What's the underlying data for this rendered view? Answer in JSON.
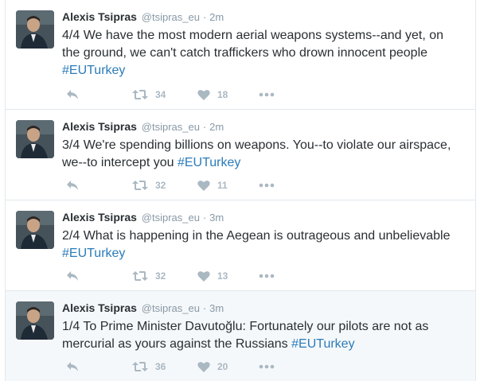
{
  "tweets": [
    {
      "name": "Alexis Tsipras",
      "handle": "@tsipras_eu",
      "separator": "·",
      "time": "2m",
      "text": "4/4 We have the most modern aerial weapons systems--and yet, on the ground, we can't catch traffickers who drown innocent people",
      "hashtag": "#EUTurkey",
      "retweets": "34",
      "likes": "18"
    },
    {
      "name": "Alexis Tsipras",
      "handle": "@tsipras_eu",
      "separator": "·",
      "time": "2m",
      "text": "3/4 We're spending billions on weapons. You--to violate our airspace, we--to intercept you",
      "hashtag": "#EUTurkey",
      "retweets": "32",
      "likes": "11"
    },
    {
      "name": "Alexis Tsipras",
      "handle": "@tsipras_eu",
      "separator": "·",
      "time": "3m",
      "text": "2/4 What is happening in the Aegean is outrageous and unbelievable",
      "hashtag": "#EUTurkey",
      "retweets": "32",
      "likes": "13"
    },
    {
      "name": "Alexis Tsipras",
      "handle": "@tsipras_eu",
      "separator": "·",
      "time": "3m",
      "text": "1/4 To Prime Minister Davutoğlu: Fortunately our pilots are not as mercurial as yours against the Russians",
      "hashtag": "#EUTurkey",
      "retweets": "36",
      "likes": "20"
    }
  ],
  "icons": {
    "reply": "reply-icon",
    "retweet": "retweet-icon",
    "like": "heart-icon",
    "more": "more-icon"
  },
  "colors": {
    "name": "#292f33",
    "meta": "#8899a6",
    "hashtag": "#2b7bb9",
    "action": "#aab8c2",
    "border": "#e1e8ed",
    "highlight": "#f5f8fa"
  }
}
